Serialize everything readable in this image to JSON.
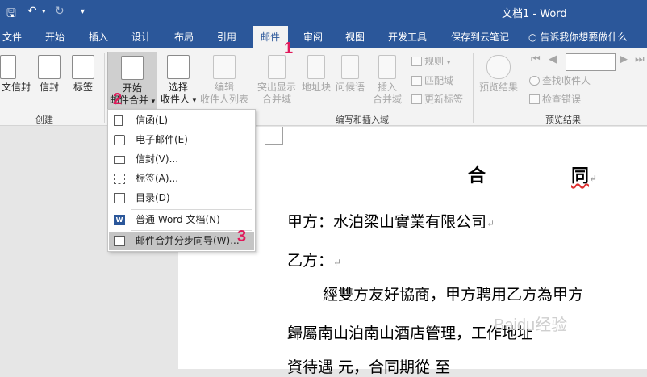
{
  "window": {
    "title": "文档1 - Word",
    "qa_icons": [
      "save-icon",
      "undo-icon",
      "redo-icon",
      "customize-icon"
    ]
  },
  "tabs": [
    "文件",
    "开始",
    "插入",
    "设计",
    "布局",
    "引用",
    "邮件",
    "审阅",
    "视图",
    "开发工具",
    "保存到云笔记"
  ],
  "tell_me": "告诉我你想要做什么",
  "ribbon": {
    "create": {
      "label": "创建",
      "envelope": "文信封",
      "letters": "信封",
      "labels": "标签"
    },
    "start_mail_merge": {
      "line1": "开始",
      "line2": "邮件合并"
    },
    "select_recipients": {
      "line1": "选择",
      "line2": "收件人"
    },
    "edit_recipients": {
      "line1": "编辑",
      "line2": "收件人列表"
    },
    "write_insert": {
      "label": "编写和插入域",
      "highlight_line1": "突出显示",
      "highlight_line2": "合并域",
      "address_block": "地址块",
      "greeting": "问候语",
      "insert_field_line1": "插入",
      "insert_field_line2": "合并域",
      "rules": "规则",
      "match_fields": "匹配域",
      "update_labels": "更新标签"
    },
    "preview": {
      "label": "预览结果",
      "preview_results": "预览结果",
      "find_recipient": "查找收件人",
      "check_errors": "检查错误"
    }
  },
  "menu": {
    "items": [
      "信函(L)",
      "电子邮件(E)",
      "信封(V)...",
      "标签(A)...",
      "目录(D)",
      "普通 Word 文档(N)",
      "邮件合并分步向导(W)..."
    ]
  },
  "annotations": [
    "1",
    "2",
    "3"
  ],
  "document": {
    "title_left": "合",
    "title_right": "同",
    "party_a": "甲方：水泊梁山實業有限公司",
    "party_b": "乙方：",
    "para1": "經雙方友好協商，甲方聘用乙方為甲方",
    "para2": "歸屬南山泊南山酒店管理，工作地址",
    "para3": "資待遇 元，合同期從 至"
  },
  "watermark": "Baidu经验"
}
